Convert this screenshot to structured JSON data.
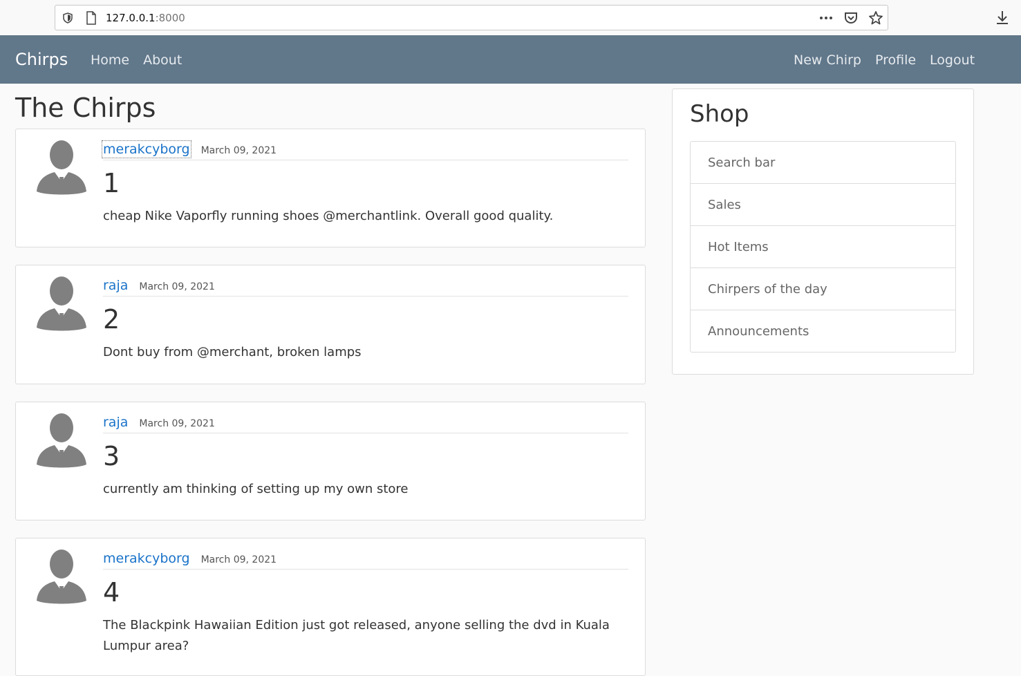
{
  "browser": {
    "url_host": "127.0.0.1",
    "url_port": ":8000"
  },
  "navbar": {
    "brand": "Chirps",
    "left_links": [
      "Home",
      "About"
    ],
    "right_links": [
      "New Chirp",
      "Profile",
      "Logout"
    ],
    "bg_color": "#61778a"
  },
  "main": {
    "title": "The Chirps",
    "chirps": [
      {
        "author": "merakcyborg",
        "date": "March 09, 2021",
        "number": "1",
        "text": "cheap Nike Vaporfly running shoes @merchantlink. Overall good quality."
      },
      {
        "author": "raja",
        "date": "March 09, 2021",
        "number": "2",
        "text": "Dont buy from @merchant, broken lamps"
      },
      {
        "author": "raja",
        "date": "March 09, 2021",
        "number": "3",
        "text": "currently am thinking of setting up my own store"
      },
      {
        "author": "merakcyborg",
        "date": "March 09, 2021",
        "number": "4",
        "text": "The Blackpink Hawaiian Edition just got released, anyone selling the dvd in Kuala Lumpur area?"
      }
    ]
  },
  "sidebar": {
    "title": "Shop",
    "items": [
      "Search bar",
      "Sales",
      "Hot Items",
      "Chirpers of the day",
      "Announcements"
    ]
  },
  "colors": {
    "link": "#1a73c9",
    "avatar": "#808080"
  }
}
